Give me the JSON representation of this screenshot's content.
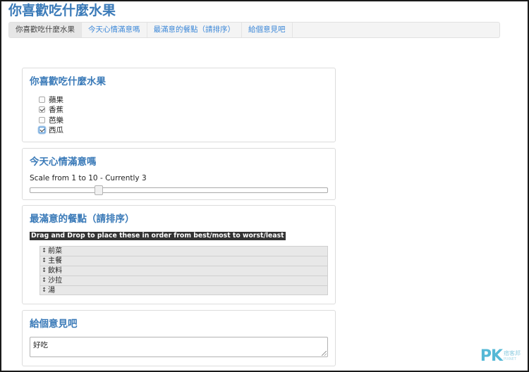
{
  "page": {
    "title": "你喜歡吃什麼水果"
  },
  "nav": {
    "items": [
      {
        "label": "你喜歡吃什麼水果",
        "active": true
      },
      {
        "label": "今天心情滿意嗎",
        "active": false
      },
      {
        "label": "最滿意的餐點（請排序）",
        "active": false
      },
      {
        "label": "給個意見吧",
        "active": false
      }
    ]
  },
  "fruit_panel": {
    "heading": "你喜歡吃什麼水果",
    "options": [
      {
        "label": "蘋果",
        "checked": false
      },
      {
        "label": "香蕉",
        "checked": true
      },
      {
        "label": "芭樂",
        "checked": false
      },
      {
        "label": "西瓜",
        "checked": true,
        "focused": true
      }
    ]
  },
  "mood_panel": {
    "heading": "今天心情滿意嗎",
    "scale_label": "Scale from 1 to 10 - Currently 3",
    "slider": {
      "min": 1,
      "max": 10,
      "value": 3
    }
  },
  "meal_panel": {
    "heading": "最滿意的餐點（請排序）",
    "instruction": "Drag and Drop to place these in order from best/most to worst/least",
    "drag_icon": "↕",
    "items": [
      "前菜",
      "主餐",
      "飲料",
      "沙拉",
      "湯"
    ]
  },
  "comment_panel": {
    "heading": "給個意見吧",
    "value": "好吃"
  },
  "watermark": {
    "logo": "PK",
    "name_cn": "痞客邦",
    "name_en": "PIXNET"
  }
}
